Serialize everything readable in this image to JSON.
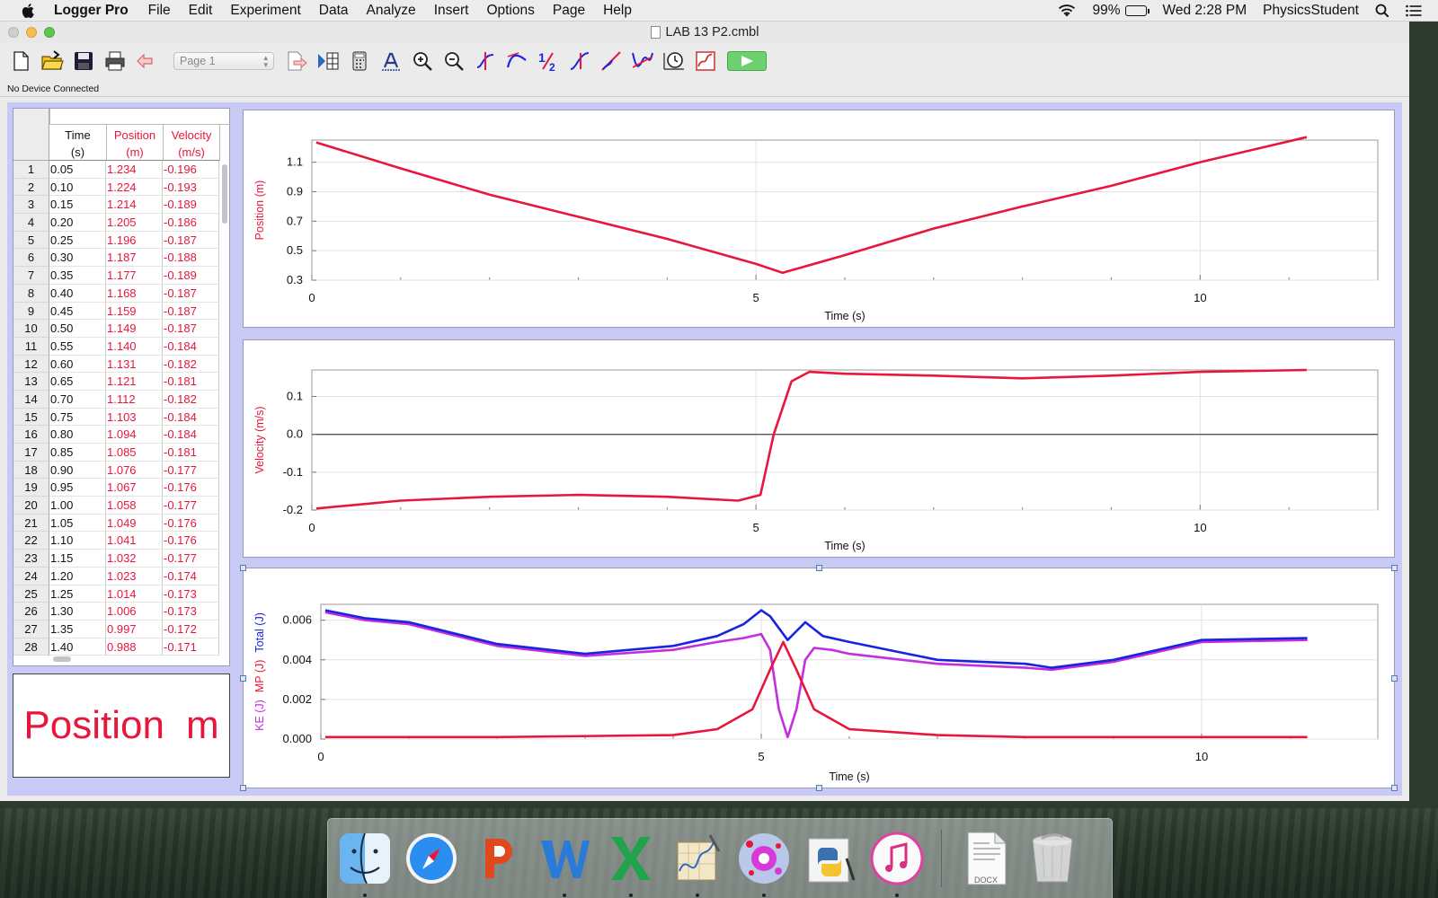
{
  "menubar": {
    "app_name": "Logger Pro",
    "items": [
      "File",
      "Edit",
      "Experiment",
      "Data",
      "Analyze",
      "Insert",
      "Options",
      "Page",
      "Help"
    ],
    "battery": "99%",
    "clock": "Wed 2:28 PM",
    "user": "PhysicsStudent"
  },
  "window": {
    "title": "LAB 13 P2.cmbl",
    "page_select": "Page 1",
    "status": "No Device Connected"
  },
  "table": {
    "columns": [
      {
        "name": "Time",
        "unit": "(s)"
      },
      {
        "name": "Position",
        "unit": "(m)"
      },
      {
        "name": "Velocity",
        "unit": "(m/s)"
      }
    ],
    "rows": [
      [
        "1",
        "0.05",
        "1.234",
        "-0.196"
      ],
      [
        "2",
        "0.10",
        "1.224",
        "-0.193"
      ],
      [
        "3",
        "0.15",
        "1.214",
        "-0.189"
      ],
      [
        "4",
        "0.20",
        "1.205",
        "-0.186"
      ],
      [
        "5",
        "0.25",
        "1.196",
        "-0.187"
      ],
      [
        "6",
        "0.30",
        "1.187",
        "-0.188"
      ],
      [
        "7",
        "0.35",
        "1.177",
        "-0.189"
      ],
      [
        "8",
        "0.40",
        "1.168",
        "-0.187"
      ],
      [
        "9",
        "0.45",
        "1.159",
        "-0.187"
      ],
      [
        "10",
        "0.50",
        "1.149",
        "-0.187"
      ],
      [
        "11",
        "0.55",
        "1.140",
        "-0.184"
      ],
      [
        "12",
        "0.60",
        "1.131",
        "-0.182"
      ],
      [
        "13",
        "0.65",
        "1.121",
        "-0.181"
      ],
      [
        "14",
        "0.70",
        "1.112",
        "-0.182"
      ],
      [
        "15",
        "0.75",
        "1.103",
        "-0.184"
      ],
      [
        "16",
        "0.80",
        "1.094",
        "-0.184"
      ],
      [
        "17",
        "0.85",
        "1.085",
        "-0.181"
      ],
      [
        "18",
        "0.90",
        "1.076",
        "-0.177"
      ],
      [
        "19",
        "0.95",
        "1.067",
        "-0.176"
      ],
      [
        "20",
        "1.00",
        "1.058",
        "-0.177"
      ],
      [
        "21",
        "1.05",
        "1.049",
        "-0.176"
      ],
      [
        "22",
        "1.10",
        "1.041",
        "-0.176"
      ],
      [
        "23",
        "1.15",
        "1.032",
        "-0.177"
      ],
      [
        "24",
        "1.20",
        "1.023",
        "-0.174"
      ],
      [
        "25",
        "1.25",
        "1.014",
        "-0.173"
      ],
      [
        "26",
        "1.30",
        "1.006",
        "-0.173"
      ],
      [
        "27",
        "1.35",
        "0.997",
        "-0.172"
      ],
      [
        "28",
        "1.40",
        "0.988",
        "-0.171"
      ]
    ]
  },
  "meter": {
    "label": "Position",
    "unit": "m"
  },
  "colors": {
    "red": "#e8163b",
    "blue": "#1a24e0",
    "magenta": "#c42de0"
  },
  "chart_data": [
    {
      "type": "line",
      "xlabel": "Time (s)",
      "ylabel": "Position (m)",
      "xlim": [
        0,
        12
      ],
      "ylim": [
        0.3,
        1.25
      ],
      "x_ticks": [
        "0",
        "5",
        "10"
      ],
      "y_ticks": [
        "0.3",
        "0.5",
        "0.7",
        "0.9",
        "1.1"
      ],
      "series": [
        {
          "name": "Position",
          "x": [
            0.05,
            1,
            2,
            3,
            4,
            5,
            5.3,
            6,
            7,
            8,
            9,
            10,
            11.2
          ],
          "values": [
            1.234,
            1.058,
            0.88,
            0.73,
            0.58,
            0.41,
            0.35,
            0.47,
            0.65,
            0.8,
            0.94,
            1.1,
            1.27
          ]
        }
      ]
    },
    {
      "type": "line",
      "xlabel": "Time (s)",
      "ylabel": "Velocity (m/s)",
      "xlim": [
        0,
        12
      ],
      "ylim": [
        -0.2,
        0.17
      ],
      "x_ticks": [
        "0",
        "5",
        "10"
      ],
      "y_ticks": [
        "-0.2",
        "-0.1",
        "0.0",
        "0.1"
      ],
      "series": [
        {
          "name": "Velocity",
          "x": [
            0.05,
            1,
            2,
            3,
            4,
            4.8,
            5.05,
            5.2,
            5.4,
            5.6,
            6,
            7,
            8,
            9,
            10,
            11.2
          ],
          "values": [
            -0.196,
            -0.175,
            -0.165,
            -0.16,
            -0.165,
            -0.175,
            -0.16,
            0.0,
            0.14,
            0.165,
            0.16,
            0.155,
            0.148,
            0.155,
            0.165,
            0.17
          ]
        }
      ]
    },
    {
      "type": "line",
      "xlabel": "Time (s)",
      "ylabel": "KE (J)  MP (J)  Total (J)",
      "xlim": [
        0,
        12
      ],
      "ylim": [
        0,
        0.0068
      ],
      "x_ticks": [
        "0",
        "5",
        "10"
      ],
      "y_ticks": [
        "0.000",
        "0.002",
        "0.004",
        "0.006"
      ],
      "series": [
        {
          "name": "KE",
          "x": [
            0.05,
            0.5,
            1,
            2,
            3,
            4,
            4.5,
            4.8,
            5.0,
            5.1,
            5.2,
            5.3,
            5.4,
            5.5,
            5.6,
            5.8,
            6,
            7,
            8,
            8.3,
            9,
            10,
            11.2
          ],
          "values": [
            0.0064,
            0.006,
            0.0058,
            0.0047,
            0.0042,
            0.0045,
            0.0049,
            0.0051,
            0.0053,
            0.0045,
            0.0015,
            0.0001,
            0.0015,
            0.004,
            0.0046,
            0.0045,
            0.0043,
            0.0038,
            0.0036,
            0.0035,
            0.0039,
            0.0049,
            0.005
          ]
        },
        {
          "name": "MP",
          "x": [
            0.05,
            2,
            4,
            4.5,
            4.9,
            5.1,
            5.25,
            5.4,
            5.6,
            6,
            7,
            8,
            11.2
          ],
          "values": [
            0.0001,
            0.0001,
            0.0002,
            0.0005,
            0.0015,
            0.0035,
            0.0049,
            0.0035,
            0.0015,
            0.0005,
            0.0002,
            0.0001,
            0.0001
          ]
        },
        {
          "name": "Total",
          "x": [
            0.05,
            0.5,
            1,
            2,
            3,
            4,
            4.5,
            4.8,
            5.0,
            5.1,
            5.3,
            5.5,
            5.7,
            6,
            7,
            8,
            8.3,
            9,
            10,
            11.2
          ],
          "values": [
            0.0065,
            0.0061,
            0.0059,
            0.0048,
            0.0043,
            0.0047,
            0.0052,
            0.0058,
            0.0065,
            0.0062,
            0.005,
            0.0059,
            0.0052,
            0.0049,
            0.004,
            0.0038,
            0.0036,
            0.004,
            0.005,
            0.0051
          ]
        }
      ]
    }
  ],
  "dock": {
    "items": [
      "Finder",
      "Safari",
      "PowerPoint",
      "Word",
      "Excel",
      "Grapher",
      "Logger Pro",
      "Python",
      "iTunes",
      "DOCX",
      "Trash"
    ],
    "docx_label": "DOCX"
  }
}
